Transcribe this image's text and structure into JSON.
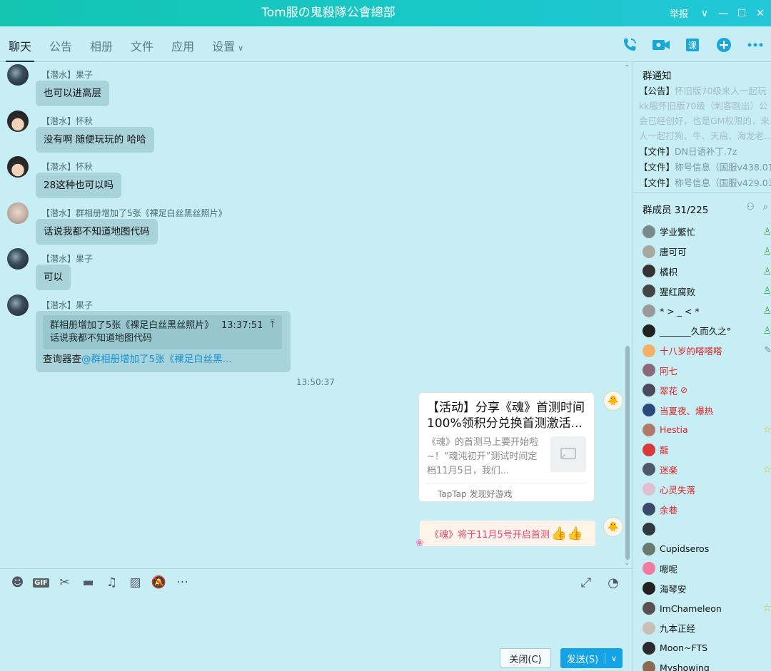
{
  "window": {
    "title": "Tom服の鬼殺隊公會總部",
    "report_label": "举报",
    "dropdown_icon": "chevron-down-icon",
    "minimize_icon": "minimize-icon",
    "maximize_icon": "maximize-icon",
    "close_icon": "close-icon"
  },
  "tabs": [
    {
      "label": "聊天",
      "active": true
    },
    {
      "label": "公告"
    },
    {
      "label": "相册"
    },
    {
      "label": "文件"
    },
    {
      "label": "应用"
    },
    {
      "label": "设置"
    }
  ],
  "tab_actions": [
    "phone-call-icon",
    "video-call-icon",
    "class-icon",
    "add-icon",
    "more-icon"
  ],
  "messages": [
    {
      "sender": "【潜水】果子",
      "text": "也可以进高层",
      "avatar": "dark"
    },
    {
      "sender": "【潜水】怀秋",
      "text": "没有啊 随便玩玩的 哈哈",
      "avatar": "boy"
    },
    {
      "sender": "【潜水】怀秋",
      "text": "28这种也可以吗",
      "avatar": "boy"
    },
    {
      "sender": "【潜水】群相册增加了5张《裸足白丝黑丝照片》",
      "text": "话说我都不知道地图代码",
      "avatar": "pale"
    },
    {
      "sender": "【潜水】果子",
      "text": "可以",
      "avatar": "dark"
    }
  ],
  "quoted_message": {
    "sender": "【潜水】果子",
    "quote_line1": "群相册增加了5张《裸足白丝黑丝照片》",
    "quote_time": "13:37:51",
    "quote_line2": "话说我都不知道地图代码",
    "reply_prefix": "查询器查",
    "reply_mention": "@群相册增加了5张《裸足白丝黑..."
  },
  "timestamp": "13:50:37",
  "share_card": {
    "title": "【活动】分享《魂》首测时间100%领积分兑换首测激活...",
    "description": "《魂》的首测马上要开始啦~！“魂沌初开”测试时间定档11月5日，我们...",
    "source": "TapTap 发现好游戏"
  },
  "sticker_message": {
    "text": "《魂》将于11月5号开启首测"
  },
  "input_toolbar": [
    "emoji-icon",
    "gif-icon",
    "scissors-icon",
    "folder-icon",
    "music-icon",
    "image-icon",
    "mute-icon",
    "more-icon"
  ],
  "buttons": {
    "close": "关闭(C)",
    "send": "发送(S)"
  },
  "right_panel": {
    "notice_title": "群通知",
    "notice_tag": "【公告】",
    "notice_text": "怀旧版70级来人一起玩kk服怀旧版70级（刺客刚出）公会已经创好，也是GM权限的，来人一起打狗、牛、天启、海龙老...",
    "files": [
      {
        "tag": "【文件】",
        "name": "DN日语补丁.7z"
      },
      {
        "tag": "【文件】",
        "name": "称号信息（国服v438.01..."
      },
      {
        "tag": "【文件】",
        "name": "称号信息（国服v429.03..."
      }
    ],
    "members_title": "群成员 31/225",
    "members": [
      {
        "name": "学业繁忙",
        "red": false,
        "badge": "green",
        "avatar": "#7a8a8c"
      },
      {
        "name": "唐可可",
        "red": false,
        "badge": "green",
        "avatar": "#a8a8a0"
      },
      {
        "name": "橘枳",
        "red": false,
        "badge": "green",
        "avatar": "#333333"
      },
      {
        "name": "猩红腐败",
        "red": false,
        "badge": "green",
        "avatar": "#454545"
      },
      {
        "name": "* > _ < *",
        "red": false,
        "badge": "green",
        "avatar": "#9a9a9a"
      },
      {
        "name": "_______久而久之°",
        "red": false,
        "badge": "green",
        "avatar": "#222222"
      },
      {
        "name": "十八岁的嗒嗒嗒",
        "red": true,
        "badge": "gray",
        "avatar": "#f2b067"
      },
      {
        "name": "阿七",
        "red": true,
        "badge": "",
        "avatar": "#8a6a7a"
      },
      {
        "name": "翠花",
        "red": true,
        "badge": "",
        "avatar": "#4a4a5a",
        "heart": true
      },
      {
        "name": "当夏夜、爆热",
        "red": true,
        "badge": "",
        "avatar": "#2a4a7a"
      },
      {
        "name": "Hestia",
        "red": true,
        "badge": "gold",
        "avatar": "#b07a6a"
      },
      {
        "name": "龍",
        "red": true,
        "badge": "",
        "avatar": "#d83a3a"
      },
      {
        "name": "迷楽",
        "red": true,
        "badge": "gold",
        "avatar": "#4a5a6a"
      },
      {
        "name": "心灵失落",
        "red": true,
        "badge": "",
        "avatar": "#e0c0d0"
      },
      {
        "name": "余巷",
        "red": true,
        "badge": "",
        "avatar": "#3a4a6a"
      },
      {
        "name": "",
        "red": false,
        "badge": "",
        "avatar": "#303840"
      },
      {
        "name": "Cupidseros",
        "red": false,
        "badge": "",
        "avatar": "#6a7a70"
      },
      {
        "name": "嗯呢",
        "red": false,
        "badge": "",
        "avatar": "#f07aa0"
      },
      {
        "name": "海琴安",
        "red": false,
        "badge": "",
        "avatar": "#222222"
      },
      {
        "name": "ImChameleon",
        "red": false,
        "badge": "gold",
        "avatar": "#5a5050"
      },
      {
        "name": "九本正经",
        "red": false,
        "badge": "",
        "avatar": "#c8c0b8"
      },
      {
        "name": "Moon~FTS",
        "red": false,
        "badge": "",
        "avatar": "#2a2a30"
      },
      {
        "name": "Myshowing",
        "red": false,
        "badge": "",
        "avatar": "#8a6a50"
      }
    ]
  }
}
